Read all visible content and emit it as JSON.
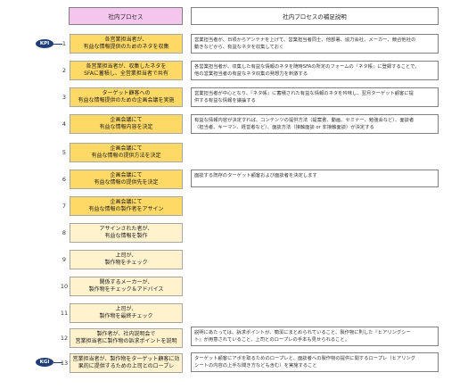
{
  "header": {
    "process": "社内プロセス",
    "notes": "社内プロセスの補足説明"
  },
  "kpi_label": "KPI",
  "kgi_label": "KGI",
  "steps": [
    {
      "num": "1",
      "text": "各営業担当者が、\n有益な情報提供のためのネタを収集",
      "note": "営業担当者が、日頃からアンテナを上げて、営業担当者同士、他部署、協力会社、メーカー、競合他社の\n動きなどから、有益なネタを収集しておく"
    },
    {
      "num": "2",
      "text": "各営業担当者が、収集したネタを\nSFAに蓄積し、全営業担当者で共有",
      "note": "各営業担当者が、収集した有益な情報のネタを随時SFAの所定のフォームの『ネタ帳』に登録することで、\n他の営業担当者の有益なネタ収集の発想力を刺激する"
    },
    {
      "num": "3",
      "text": "ターゲット顧客への\n有益な情報提供のための企画会議を実施",
      "note": "営業担当者が中心となり、『ネタ帳』に蓄積された有益な情報のネタを吟味し、翌月ターゲット顧客に提\n供する有益な情報を議論する"
    },
    {
      "num": "4",
      "text": "企画会議にて\n有益な情報内容を決定",
      "note": "有益な情報内容が決定すれば、コンテンツの提供方法（提案書、動画、セミナー、勉強会など）、面談者\n（担当者、キーマン、経営者など）、面談方法（接触面談 or 非接触面談）が決定する"
    },
    {
      "num": "5",
      "text": "企画会議にて\n有益な情報の提供方法を決定",
      "note": ""
    },
    {
      "num": "6",
      "text": "企画会議にて\n有益な情報の提供先を決定",
      "note": "面談する既存のターゲット顧客および面談者を決定します"
    },
    {
      "num": "7",
      "text": "企画会議にて\n有益な情報の製作者をアサイン",
      "note": ""
    },
    {
      "num": "8",
      "text": "アサインされた者が、\n有益な情報を製作",
      "note": ""
    },
    {
      "num": "9",
      "text": "上司が、\n製作物をチェック",
      "note": ""
    },
    {
      "num": "10",
      "text": "関係するメーカーが、\n製作物をチェック＆アドバイス",
      "note": ""
    },
    {
      "num": "11",
      "text": "上司が、\n製作物を最終チェック",
      "note": ""
    },
    {
      "num": "12",
      "text": "製作者が、社内説明会で\n営業担当者に製作物の訴求ポイントを説明",
      "note": "説明にあたっては、訴求ポイントが、簡潔にまとめられていること、製作物に則した『ヒアリングシー\nト』が用意されていること、上司とのロープレの手本も見せられること。"
    },
    {
      "num": "13",
      "text": "営業担当者が、製作物をターゲット顧客に効\n果的に提供するための上司とのロープレ",
      "note": "ターゲット顧客にアポを取るためのロープレと、面談者への製作物の提供に関するロープレ（ヒアリング\nシートの内容の上手な聞き方なども含む）を実施すること"
    }
  ]
}
